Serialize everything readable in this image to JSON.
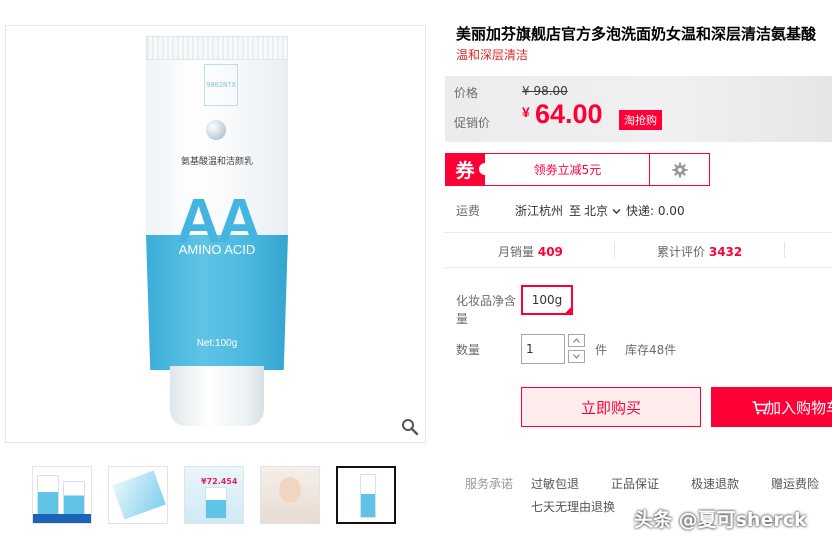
{
  "product": {
    "title": "美丽加芬旗舰店官方多泡洗面奶女温和深层清洁氨基酸",
    "subtitle": "温和深层清洁",
    "image_text": {
      "code": "9802N7X",
      "name_cn": "氨基酸温和洁颜乳",
      "big_letters": "AA",
      "amino": "AMINO ACID",
      "net": "Net:100g"
    },
    "thumbnails": [
      {
        "name": "thumbnail-1"
      },
      {
        "name": "thumbnail-2"
      },
      {
        "name": "thumbnail-3",
        "badge": "¥72.454"
      },
      {
        "name": "thumbnail-4"
      },
      {
        "name": "thumbnail-5"
      }
    ],
    "active_thumbnail_index": 4
  },
  "price": {
    "label_original": "价格",
    "original": "¥ 98.00",
    "label_promo": "促销价",
    "currency": "¥",
    "promo_value": "64.00",
    "tag": "淘抢购"
  },
  "coupon": {
    "badge": "券",
    "text": "领劵立减5元"
  },
  "shipping": {
    "label": "运费",
    "from": "浙江杭州",
    "to_word": "至",
    "destination": "北京",
    "fee": "快递: 0.00"
  },
  "stats": {
    "monthly_sales_label": "月销量",
    "monthly_sales": "409",
    "reviews_label": "累计评价",
    "reviews": "3432"
  },
  "spec": {
    "label": "化妆品净含量",
    "option": "100g"
  },
  "quantity": {
    "label": "数量",
    "value": "1",
    "unit": "件",
    "stock": "库存48件"
  },
  "actions": {
    "buy_now": "立即购买",
    "add_to_cart": "加入购物车"
  },
  "service": {
    "label": "服务承诺",
    "items": [
      "过敏包退",
      "正品保证",
      "极速退款",
      "赠运费险",
      "七天无理由退换"
    ]
  },
  "watermark": "头条 @夏可sherck",
  "colors": {
    "accent": "#ff0036",
    "product_blue": "#43b5e0"
  },
  "icons": {
    "zoom": "magnifier-icon",
    "gear": "gear-icon",
    "cart": "cart-icon"
  }
}
